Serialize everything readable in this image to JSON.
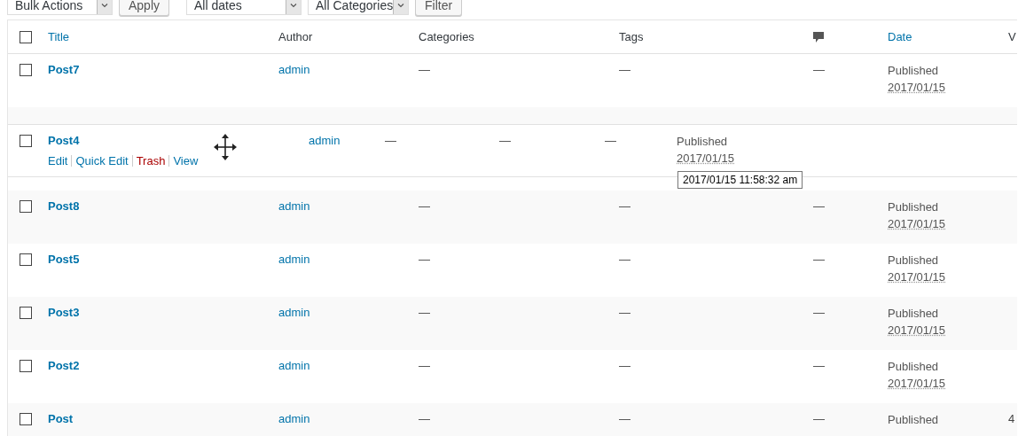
{
  "toolbar": {
    "bulk_actions": "Bulk Actions",
    "apply": "Apply",
    "dates": "All dates",
    "categories": "All Categories",
    "filter": "Filter"
  },
  "table": {
    "header": {
      "checked": false,
      "columns": [
        {
          "kind": "text",
          "label": "Title",
          "sortable": true
        },
        {
          "kind": "text",
          "label": "Author",
          "sortable": false
        },
        {
          "kind": "text",
          "label": "Categories",
          "sortable": false
        },
        {
          "kind": "text",
          "label": "Tags",
          "sortable": false
        },
        {
          "kind": "comments-icon"
        },
        {
          "kind": "text",
          "label": "Date",
          "sortable": true
        },
        {
          "kind": "text",
          "label": "V",
          "sortable": false
        }
      ]
    },
    "rows": [
      {
        "kind": "post",
        "title": "Post7",
        "author": "admin",
        "categories": "—",
        "tags": "—",
        "comments": "—",
        "status": "Published",
        "date": "2017/01/15",
        "checked": false
      },
      {
        "kind": "covered"
      },
      {
        "kind": "placeholder"
      },
      {
        "kind": "post",
        "title": "Post8",
        "author": "admin",
        "categories": "—",
        "tags": "—",
        "comments": "—",
        "status": "Published",
        "date": "2017/01/15",
        "checked": false
      },
      {
        "kind": "post",
        "title": "Post5",
        "author": "admin",
        "categories": "—",
        "tags": "—",
        "comments": "—",
        "status": "Published",
        "date": "2017/01/15",
        "checked": false
      },
      {
        "kind": "post",
        "title": "Post3",
        "author": "admin",
        "categories": "—",
        "tags": "—",
        "comments": "—",
        "status": "Published",
        "date": "2017/01/15",
        "checked": false
      },
      {
        "kind": "post",
        "title": "Post2",
        "author": "admin",
        "categories": "—",
        "tags": "—",
        "comments": "—",
        "status": "Published",
        "date": "2017/01/15",
        "checked": false
      },
      {
        "kind": "post",
        "title": "Post",
        "author": "admin",
        "categories": "—",
        "tags": "—",
        "comments": "—",
        "status": "Published",
        "column_8": "4",
        "checked": false
      }
    ],
    "dragged_row": {
      "title": "Post4",
      "author": "admin",
      "categories": "—",
      "tags": "—",
      "comments": "—",
      "status": "Published",
      "date": "2017/01/15",
      "checked": false,
      "row_actions": [
        {
          "label": "Edit",
          "kind": "link"
        },
        {
          "label": "Quick Edit",
          "kind": "link"
        },
        {
          "label": "Trash",
          "kind": "danger"
        },
        {
          "label": "View",
          "kind": "link"
        }
      ],
      "tooltip": "2017/01/15 11:58:32 am"
    }
  }
}
